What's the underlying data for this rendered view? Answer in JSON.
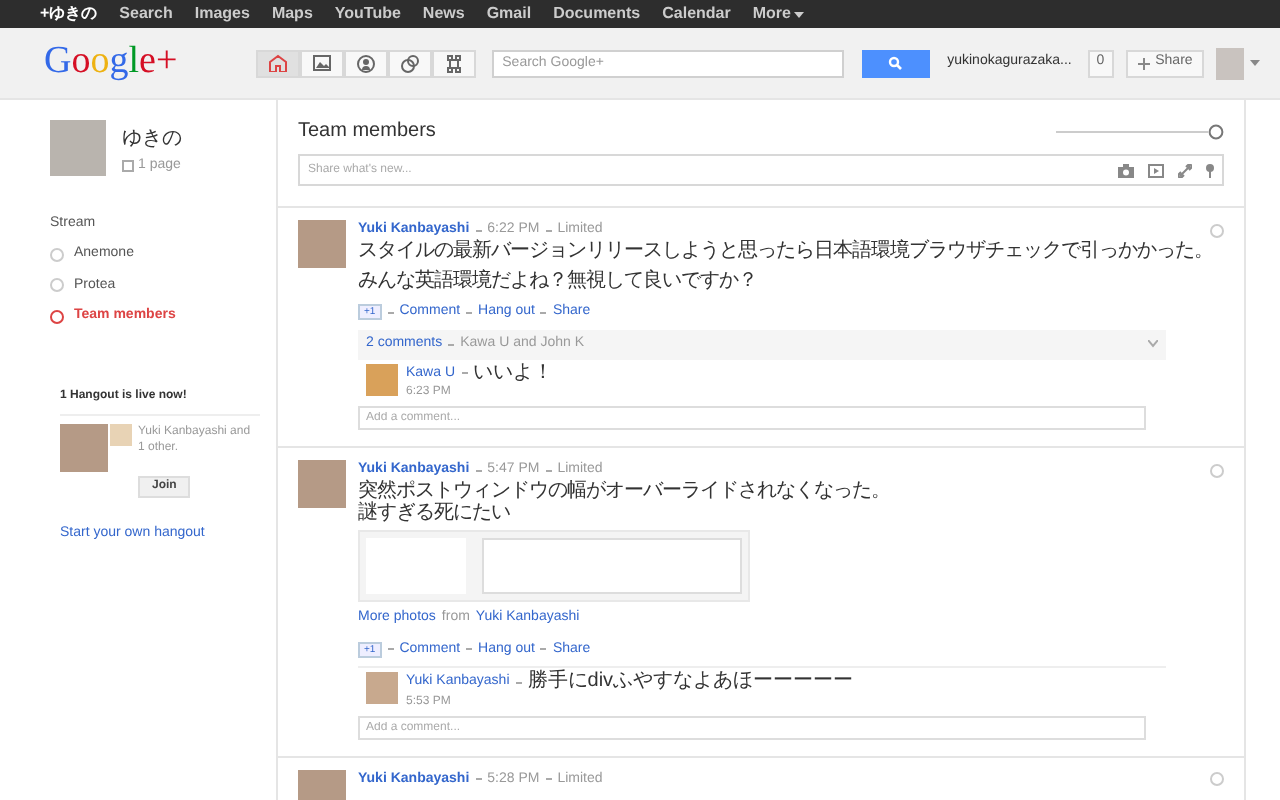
{
  "top_bar": {
    "user": "+ゆきの",
    "links": [
      "Search",
      "Images",
      "Maps",
      "YouTube",
      "News",
      "Gmail",
      "Documents",
      "Calendar"
    ],
    "more": "More"
  },
  "header": {
    "logo": "Google+",
    "nav": [
      {
        "kind": "home",
        "selected": true
      },
      {
        "kind": "photos",
        "selected": false
      },
      {
        "kind": "profile",
        "selected": false
      },
      {
        "kind": "circles",
        "selected": false
      },
      {
        "kind": "games",
        "selected": false
      }
    ],
    "search": {
      "placeholder": "Search Google+"
    },
    "user_name": "yukinokagurazaka...",
    "notifications": "0",
    "share": "Share"
  },
  "sidebar": {
    "profile_name": "ゆきの",
    "pages": "1 page",
    "stream_label": "Stream",
    "circles": [
      {
        "label": "Anemone",
        "selected": false
      },
      {
        "label": "Protea",
        "selected": false
      },
      {
        "label": "Team members",
        "selected": true
      }
    ],
    "hangout": {
      "title": "1 Hangout is live now!",
      "text": "Yuki Kanbayashi and 1 other.",
      "join": "Join"
    },
    "start_hangout": "Start your own hangout"
  },
  "stream": {
    "title": "Team members",
    "share_placeholder": "Share what's new...",
    "posts": [
      {
        "author": "Yuki Kanbayashi",
        "time": "6:22 PM",
        "visibility": "Limited",
        "paragraphs": [
          [
            "スタイルの最新バージョンリリースしようと思ったら日本語環境ブラウザチェックで引っかかった。"
          ],
          [
            "みんな英語環境だよね？無視して良いですか？"
          ]
        ],
        "plus_one": "+1",
        "actions": [
          "Comment",
          "Hang out",
          "Share"
        ],
        "comments_summary": {
          "count": "2 comments",
          "names": "Kawa U and John K"
        },
        "comments": [
          {
            "author": "Kawa U",
            "text": "いいよ！",
            "time": "6:23 PM"
          }
        ],
        "add_comment_placeholder": "Add a comment..."
      },
      {
        "author": "Yuki Kanbayashi",
        "time": "5:47 PM",
        "visibility": "Limited",
        "paragraphs": [
          [
            "突然ポストウィンドウの幅がオーバーライドされなくなった。",
            "謎すぎる死にたい"
          ]
        ],
        "photo": true,
        "more_photos": {
          "link": "More photos",
          "from": "from",
          "author": "Yuki Kanbayashi"
        },
        "plus_one": "+1",
        "actions": [
          "Comment",
          "Hang out",
          "Share"
        ],
        "comments": [
          {
            "author": "Yuki Kanbayashi",
            "text": "勝手にdivふやすなよあほーーーーー",
            "time": "5:53 PM"
          }
        ],
        "add_comment_placeholder": "Add a comment..."
      },
      {
        "author": "Yuki Kanbayashi",
        "time": "5:28 PM",
        "visibility": "Limited"
      }
    ]
  }
}
